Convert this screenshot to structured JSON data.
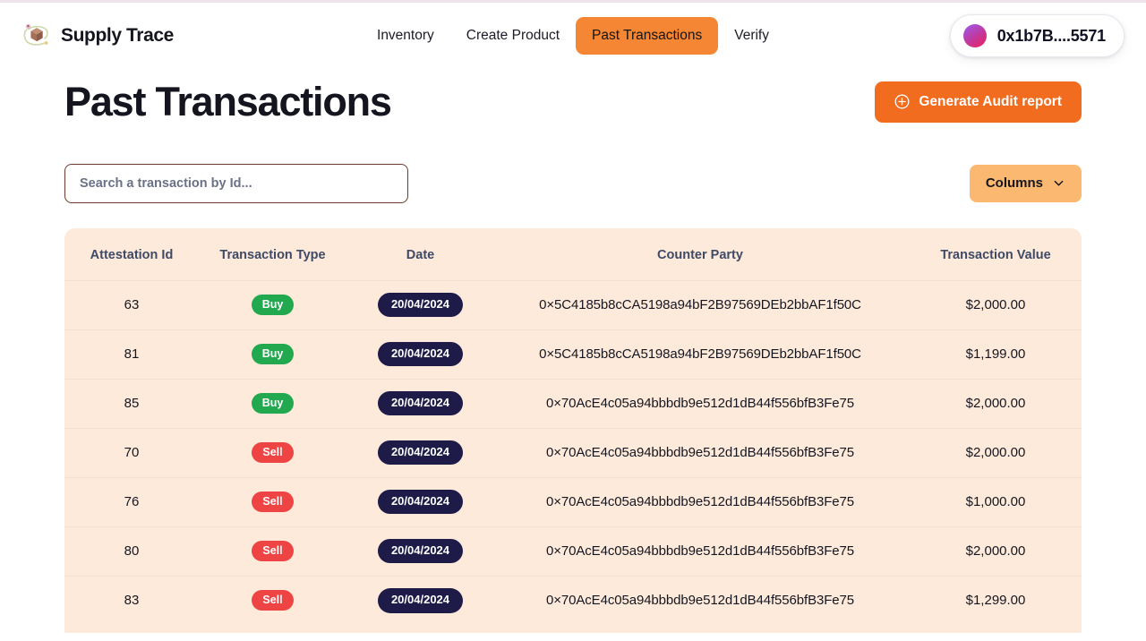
{
  "header": {
    "brand_name": "Supply Trace",
    "logo_icon": "package-trace-logo",
    "nav": [
      {
        "label": "Inventory",
        "active": false
      },
      {
        "label": "Create Product",
        "active": false
      },
      {
        "label": "Past Transactions",
        "active": true
      },
      {
        "label": "Verify",
        "active": false
      }
    ],
    "wallet": {
      "address": "0x1b7B....5571",
      "avatar_icon": "wallet-avatar-gradient"
    }
  },
  "page": {
    "title": "Past Transactions",
    "audit_button": {
      "label": "Generate Audit report",
      "icon": "plus-circle-icon"
    }
  },
  "toolbar": {
    "search_placeholder": "Search a transaction by Id...",
    "search_value": "",
    "columns_button": {
      "label": "Columns",
      "icon": "chevron-down-icon"
    }
  },
  "table": {
    "columns": [
      "Attestation Id",
      "Transaction Type",
      "Date",
      "Counter Party",
      "Transaction Value"
    ],
    "rows": [
      {
        "attestation_id": "63",
        "transaction_type": "Buy",
        "date": "20/04/2024",
        "counter_party": "0×5C4185b8cCA5198a94bF2B97569DEb2bbAF1f50C",
        "transaction_value": "$2,000.00"
      },
      {
        "attestation_id": "81",
        "transaction_type": "Buy",
        "date": "20/04/2024",
        "counter_party": "0×5C4185b8cCA5198a94bF2B97569DEb2bbAF1f50C",
        "transaction_value": "$1,199.00"
      },
      {
        "attestation_id": "85",
        "transaction_type": "Buy",
        "date": "20/04/2024",
        "counter_party": "0×70AcE4c05a94bbbdb9e512d1dB44f556bfB3Fe75",
        "transaction_value": "$2,000.00"
      },
      {
        "attestation_id": "70",
        "transaction_type": "Sell",
        "date": "20/04/2024",
        "counter_party": "0×70AcE4c05a94bbbdb9e512d1dB44f556bfB3Fe75",
        "transaction_value": "$2,000.00"
      },
      {
        "attestation_id": "76",
        "transaction_type": "Sell",
        "date": "20/04/2024",
        "counter_party": "0×70AcE4c05a94bbbdb9e512d1dB44f556bfB3Fe75",
        "transaction_value": "$1,000.00"
      },
      {
        "attestation_id": "80",
        "transaction_type": "Sell",
        "date": "20/04/2024",
        "counter_party": "0×70AcE4c05a94bbbdb9e512d1dB44f556bfB3Fe75",
        "transaction_value": "$2,000.00"
      },
      {
        "attestation_id": "83",
        "transaction_type": "Sell",
        "date": "20/04/2024",
        "counter_party": "0×70AcE4c05a94bbbdb9e512d1dB44f556bfB3Fe75",
        "transaction_value": "$1,299.00"
      }
    ]
  },
  "colors": {
    "accent_orange": "#f26c20",
    "nav_active_orange": "#f58634",
    "columns_orange": "#fbb871",
    "table_bg": "#fdeadb",
    "badge_buy_green": "#22a94f",
    "badge_sell_red": "#ef4444",
    "date_pill_navy": "#1e1b48"
  }
}
